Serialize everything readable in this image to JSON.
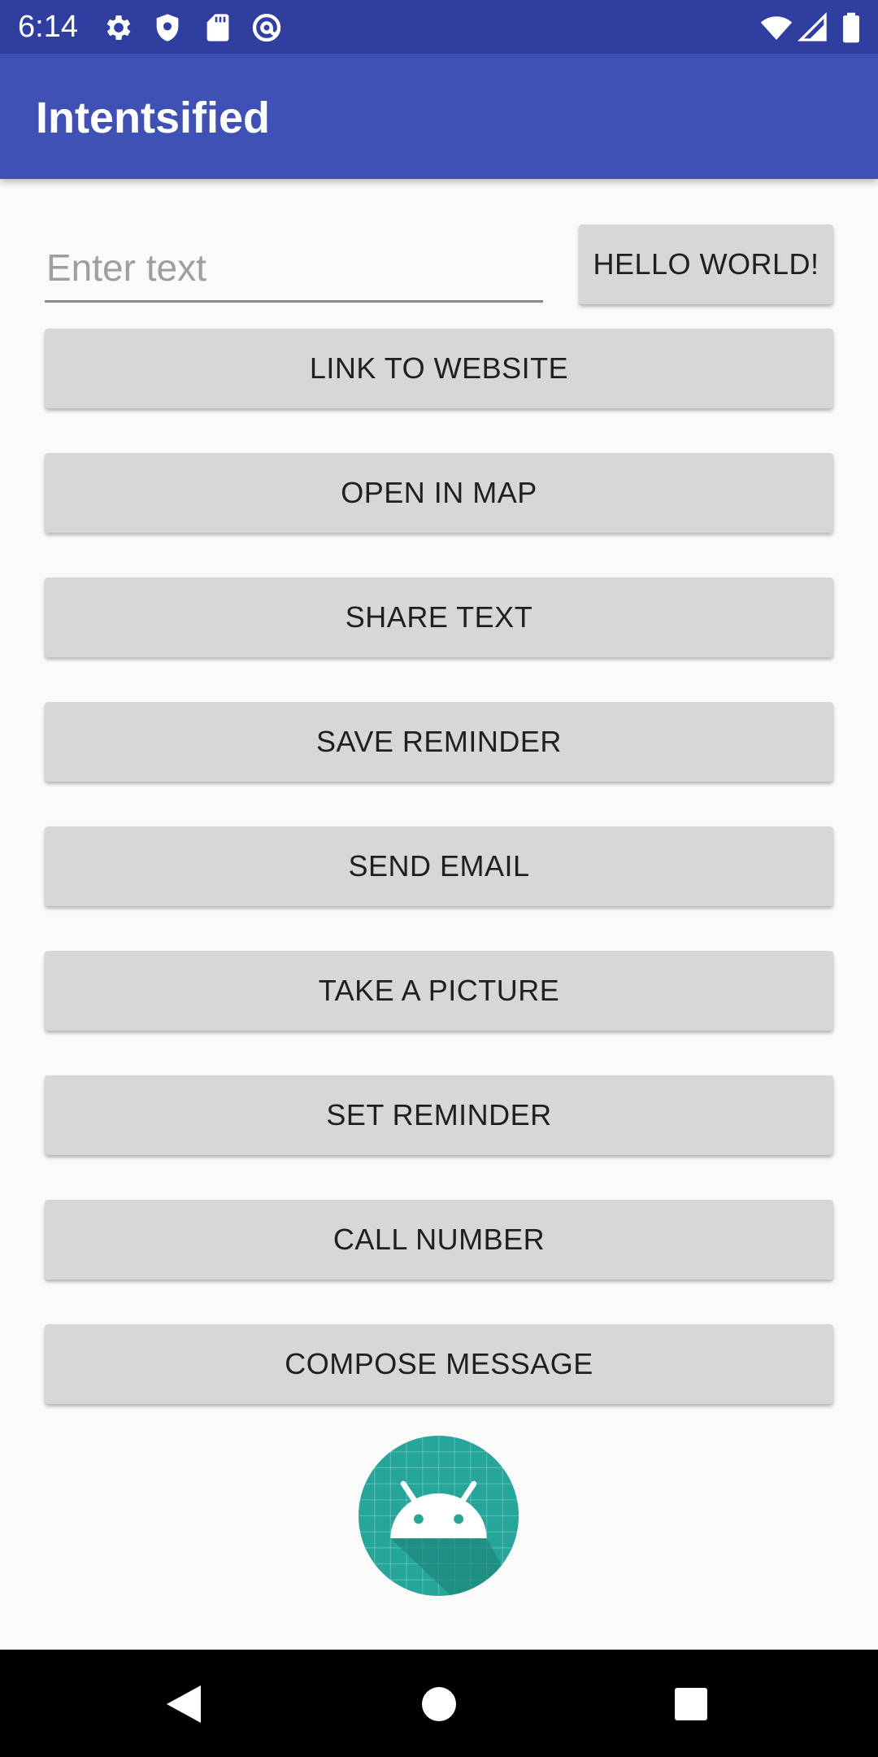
{
  "status_bar": {
    "time": "6:14",
    "icons_left": [
      "gear-icon",
      "shield-icon",
      "sd-card-icon",
      "at-sign-icon"
    ],
    "icons_right": [
      "wifi-icon",
      "cell-signal-icon",
      "battery-icon"
    ]
  },
  "app_bar": {
    "title": "Intentsified",
    "color": "#3f51b5",
    "status_color": "#303f9f"
  },
  "form": {
    "input_placeholder": "Enter text",
    "input_value": "",
    "hello_button": "HELLO WORLD!"
  },
  "buttons": [
    "LINK TO WEBSITE",
    "OPEN IN MAP",
    "SHARE TEXT",
    "SAVE REMINDER",
    "SEND EMAIL",
    "TAKE A PICTURE",
    "SET REMINDER",
    "CALL NUMBER",
    "COMPOSE MESSAGE"
  ],
  "logo": {
    "icon": "android-logo-icon",
    "color": "#26a69a"
  },
  "nav_bar": {
    "icons": [
      "back-icon",
      "home-icon",
      "recents-icon"
    ]
  }
}
